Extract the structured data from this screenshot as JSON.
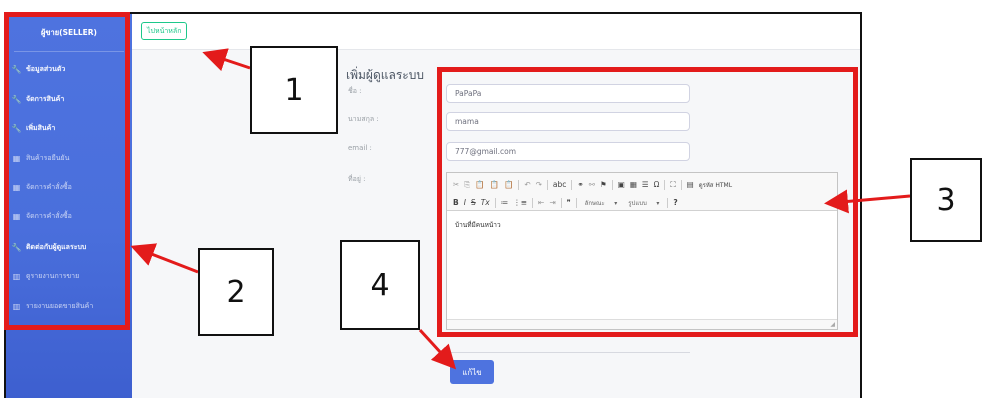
{
  "sidebar": {
    "brand": "ผู้ขาย(SELLER)",
    "items": [
      {
        "label": "ข้อมูลส่วนตัว",
        "icon": "wrench-icon"
      },
      {
        "label": "จัดการสินค้า",
        "icon": "wrench-icon"
      },
      {
        "label": "เพิ่มสินค้า",
        "icon": "wrench-icon"
      },
      {
        "label": "สินค้ารอยืนยัน",
        "icon": "table-icon"
      },
      {
        "label": "จัดการคำสั่งซื้อ",
        "icon": "table-icon"
      },
      {
        "label": "จัดการคำสั่งซื้อ",
        "icon": "table-icon"
      },
      {
        "label": "ติดต่อกับผู้ดูแลระบบ",
        "icon": "wrench-icon"
      },
      {
        "label": "ดูรายงานการขาย",
        "icon": "chart-icon"
      },
      {
        "label": "รายงานยอดขายสินค้า",
        "icon": "chart-icon"
      }
    ]
  },
  "topbar": {
    "home_label": "ไปหน้าหลัก"
  },
  "form": {
    "title": "เพิ่มผู้ดูแลระบบ",
    "name_label": "ชื่อ :",
    "name_value": "PaPaPa",
    "surname_label": "นามสกุล :",
    "surname_value": "mama",
    "email_label": "email :",
    "email_value": "777@gmail.com",
    "address_label": "ที่อยู่ :",
    "address_value": "บ้านที่มีคนหน้าว",
    "submit_label": "แก้ไข"
  },
  "editor": {
    "row1": [
      "✂",
      "⎘",
      "📋",
      "📋",
      "📋",
      "↶",
      "↷",
      "abc",
      "⚭",
      "⚯",
      "⚑",
      "▣",
      "▦",
      "☰",
      "Ω",
      "⛶",
      "▤",
      "ดูรหัส HTML"
    ],
    "row2": [
      "B",
      "I",
      "S",
      "Tx",
      "≔",
      "⋮≡",
      "⇤",
      "⇥",
      "❞",
      "ลักษณะ",
      "รูปแบบ",
      "?"
    ]
  },
  "annotations": {
    "labels": [
      "1",
      "2",
      "3",
      "4"
    ],
    "color": "#e31b1b"
  }
}
